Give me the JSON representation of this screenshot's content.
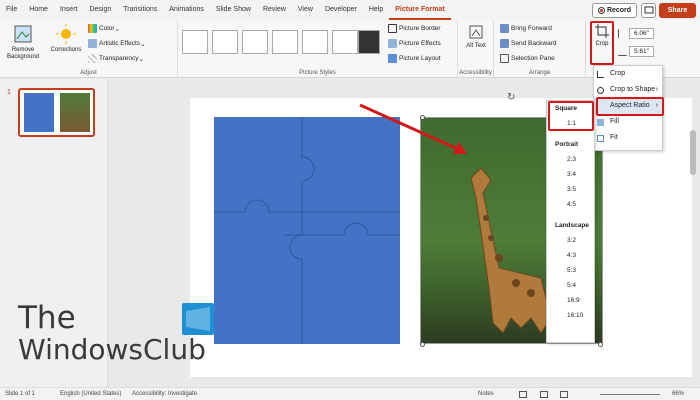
{
  "tabs": [
    "File",
    "Home",
    "Insert",
    "Design",
    "Transitions",
    "Animations",
    "Slide Show",
    "Review",
    "View",
    "Developer",
    "Help",
    "Picture Format"
  ],
  "active_tab": "Picture Format",
  "top_right": {
    "record": "Record",
    "share": "Share"
  },
  "ribbon": {
    "adjust": {
      "remove_bg": "Remove Background",
      "corrections": "Corrections",
      "color": "Color",
      "artistic": "Artistic Effects",
      "transparency": "Transparency",
      "label": "Adjust"
    },
    "styles": {
      "label": "Picture Styles",
      "border": "Picture Border",
      "effects": "Picture Effects",
      "layout": "Picture Layout"
    },
    "access": {
      "alt": "Alt Text",
      "label": "Accessibility"
    },
    "arrange": {
      "forward": "Bring Forward",
      "backward": "Send Backward",
      "pane": "Selection Pane",
      "label": "Arrange"
    },
    "crop": {
      "label": "Crop",
      "height": "6.06\"",
      "width": "5.61\""
    }
  },
  "slide_number": "1",
  "crop_menu": {
    "crop": "Crop",
    "crop_to_shape": "Crop to Shape",
    "aspect_ratio": "Aspect Ratio",
    "fill": "Fill",
    "fit": "Fit"
  },
  "aspect_menu": {
    "square_header": "Square",
    "square": [
      "1:1"
    ],
    "portrait_header": "Portrait",
    "portrait": [
      "2:3",
      "3:4",
      "3:5",
      "4:5"
    ],
    "landscape_header": "Landscape",
    "landscape": [
      "3:2",
      "4:3",
      "5:3",
      "5:4",
      "16:9",
      "16:10"
    ]
  },
  "watermark": {
    "line1": "The",
    "line2": "WindowsClub"
  },
  "status": {
    "slide": "Slide 1 of 1",
    "lang": "English (United States)",
    "access": "Accessibility: Investigate",
    "notes": "Notes",
    "zoom": "66%"
  },
  "colors": {
    "accent": "#c43e1c",
    "highlight": "#d21a1a",
    "puzzle": "#4472c4"
  }
}
